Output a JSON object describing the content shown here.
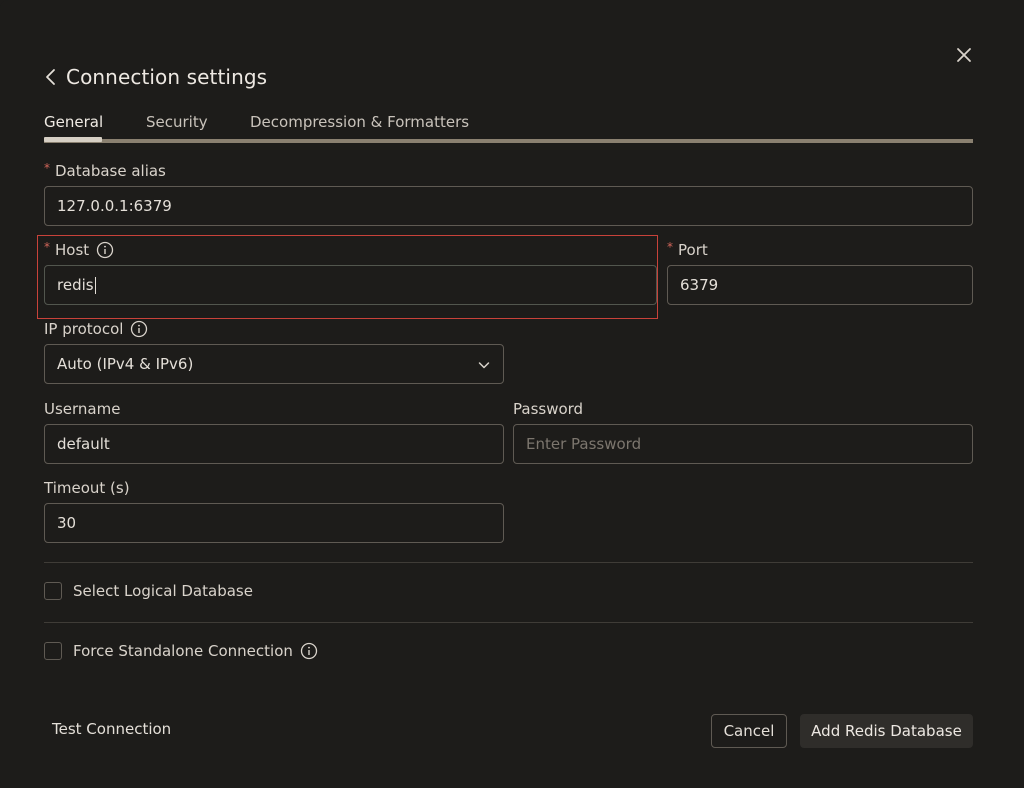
{
  "dialog": {
    "title": "Connection settings"
  },
  "tabs": [
    {
      "label": "General",
      "active": true
    },
    {
      "label": "Security",
      "active": false
    },
    {
      "label": "Decompression & Formatters",
      "active": false
    }
  ],
  "fields": {
    "alias": {
      "label": "Database alias",
      "required": true,
      "value": "127.0.0.1:6379"
    },
    "host": {
      "label": "Host",
      "required": true,
      "value": "redis"
    },
    "port": {
      "label": "Port",
      "required": true,
      "value": "6379"
    },
    "ip_protocol": {
      "label": "IP protocol",
      "value": "Auto (IPv4 & IPv6)"
    },
    "username": {
      "label": "Username",
      "value": "default"
    },
    "password": {
      "label": "Password",
      "value": "",
      "placeholder": "Enter Password"
    },
    "timeout": {
      "label": "Timeout (s)",
      "value": "30"
    }
  },
  "checkboxes": {
    "logical_db": {
      "label": "Select Logical Database",
      "checked": false
    },
    "standalone": {
      "label": "Force Standalone Connection",
      "checked": false
    }
  },
  "footer": {
    "test_connection": "Test Connection",
    "cancel": "Cancel",
    "submit": "Add Redis Database"
  },
  "required_marker": "*",
  "colors": {
    "background": "#1d1c1a",
    "error_outline": "#c8423a",
    "required": "#d2665a",
    "primary_button": "#2f2d2a"
  },
  "icons": {
    "close": "close-icon",
    "back": "chevron-left-icon",
    "info": "info-icon",
    "dropdown": "chevron-down-icon"
  }
}
